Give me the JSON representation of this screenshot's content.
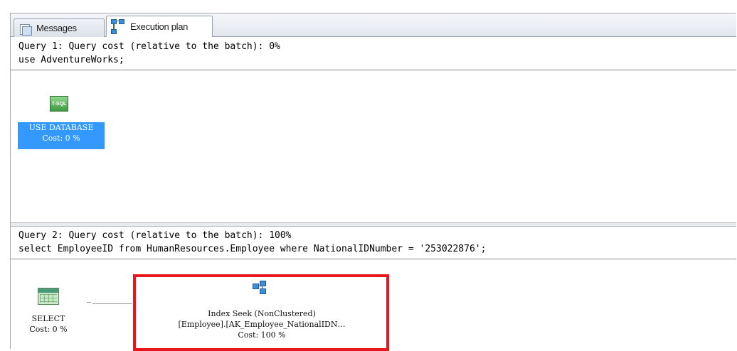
{
  "tabs": [
    {
      "label": "Messages",
      "icon": "messages-icon",
      "active": false
    },
    {
      "label": "Execution plan",
      "icon": "execution-plan-icon",
      "active": true
    }
  ],
  "query1": {
    "header": "Query 1: Query cost (relative to the batch): 0%",
    "sql": "use AdventureWorks;",
    "node": {
      "icon": "tsql-icon",
      "icon_text": "T-SQL",
      "title": "USE DATABASE",
      "cost": "Cost: 0 %"
    }
  },
  "query2": {
    "header": "Query 2: Query cost (relative to the batch): 100%",
    "sql": "select EmployeeID from HumanResources.Employee where NationalIDNumber = '253022876';",
    "select_node": {
      "icon": "select-icon",
      "title": "SELECT",
      "cost": "Cost: 0 %"
    },
    "seek_node": {
      "icon": "index-seek-icon",
      "title": "Index Seek (NonClustered)",
      "object": "[Employee].[AK_Employee_NationalIDN…",
      "cost": "Cost: 100 %",
      "highlight_color": "#e8161f"
    }
  },
  "colors": {
    "selection": "#3399ff",
    "highlight": "#e8161f"
  }
}
